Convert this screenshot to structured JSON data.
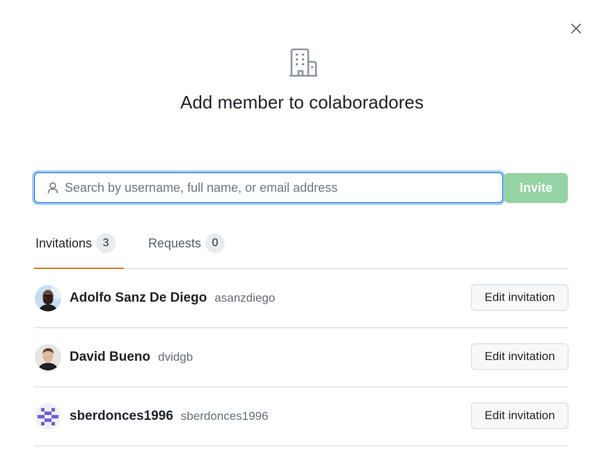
{
  "dialog": {
    "close_icon": "x-icon",
    "header_icon": "organization-icon",
    "title": "Add member to colaboradores"
  },
  "search": {
    "icon": "person-icon",
    "placeholder": "Search by username, full name, or email address",
    "value": ""
  },
  "invite_button": {
    "label": "Invite",
    "color": "#94d3a2"
  },
  "tabs": [
    {
      "label": "Invitations",
      "count": "3",
      "selected": true
    },
    {
      "label": "Requests",
      "count": "0",
      "selected": false
    }
  ],
  "accent_color": "#d07a2e",
  "invitations": [
    {
      "name": "Adolfo Sanz De Diego",
      "login": "asanzdiego",
      "button": "Edit invitation"
    },
    {
      "name": "David Bueno",
      "login": "dvidgb",
      "button": "Edit invitation"
    },
    {
      "name": "sberdonces1996",
      "login": "sberdonces1996",
      "button": "Edit invitation"
    }
  ]
}
